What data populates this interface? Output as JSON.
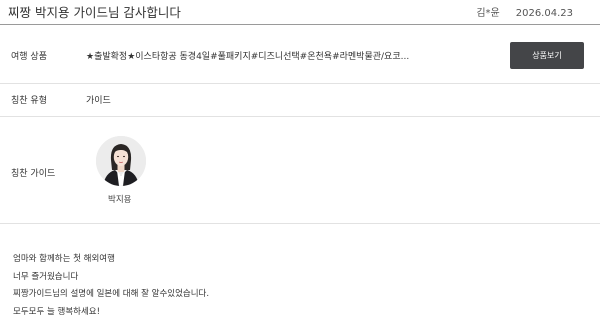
{
  "header": {
    "title": "찌짱 박지용 가이드님 감사합니다",
    "author": "김*윤",
    "date": "2026.04.23"
  },
  "product": {
    "label": "여행 상품",
    "value": "★출발확정★이스타항공 동경4일#풀패키지#디즈니선택#온천욕#라멘박물관/요코...",
    "button_label": "상품보기"
  },
  "praise_type": {
    "label": "칭찬 유형",
    "value": "가이드"
  },
  "praise_guide": {
    "label": "칭찬 가이드",
    "name": "박지용"
  },
  "review": {
    "lines": [
      "엄마와 함께하는 첫 해외여행",
      "너무 즐거웠습니다",
      "찌짱가이드님의 설명에 일본에 대해 잘 알수있었습니다.",
      "모두모두 늘 행복하세요!"
    ]
  }
}
